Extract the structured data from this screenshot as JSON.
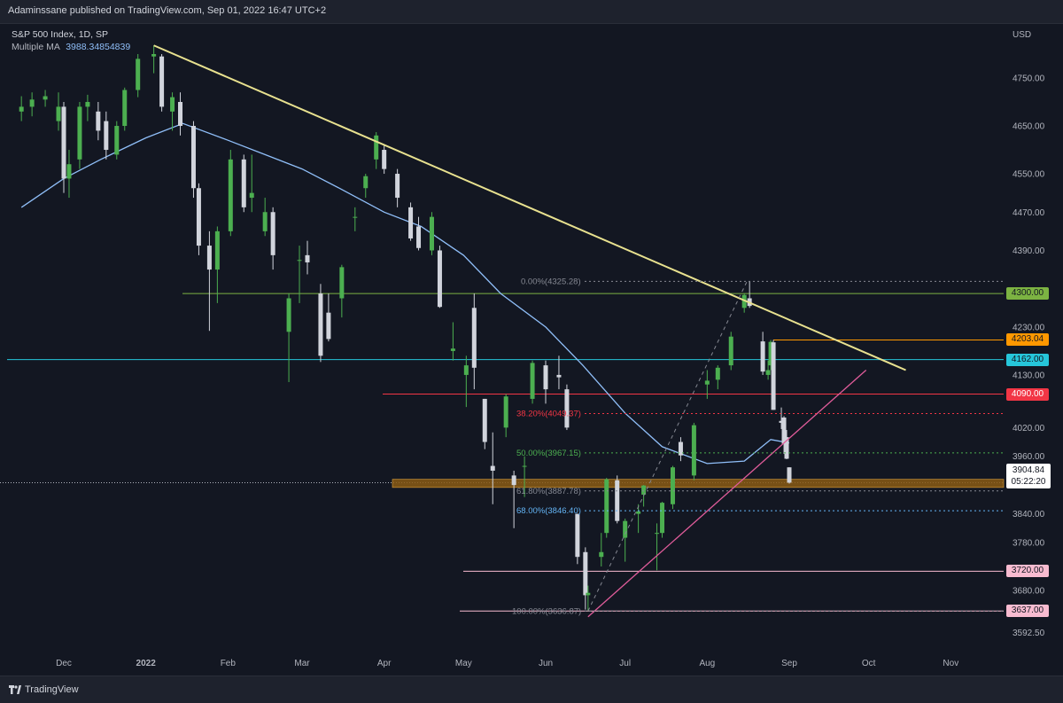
{
  "header": {
    "published_line": "Adaminssane published on TradingView.com, Sep 01, 2022 16:47 UTC+2"
  },
  "legend": {
    "symbol_line": "S&P 500 Index, 1D, SP",
    "ma_label": "Multiple MA",
    "ma_value": "3988.34854839"
  },
  "footer": {
    "brand": "TradingView"
  },
  "colors": {
    "background": "#131722",
    "up_candle": "#4caf50",
    "down_candle": "#d1d4dc",
    "ma_line": "#90bff9",
    "trend_line_yellow": "#e8e18f",
    "support_pink": "#e05c9a",
    "level_cyan": "#26c6da",
    "level_red": "#f23645",
    "level_orange": "#ff9800",
    "level_green": "#7cb342",
    "zone_orange": "#8a5a14"
  },
  "chart_data": {
    "type": "candlestick",
    "title": "S&P 500 Index, 1D, SP",
    "currency_label": "USD",
    "x_tick_labels": [
      "Dec",
      "2022",
      "Feb",
      "Mar",
      "Apr",
      "May",
      "Jun",
      "Jul",
      "Aug",
      "Sep",
      "Oct",
      "Nov"
    ],
    "y_tick_labels": [
      4750,
      4650,
      4550,
      4470,
      4390,
      4230,
      4130,
      4020,
      3960,
      3840,
      3780,
      3680,
      3592.5
    ],
    "ylim": [
      3560,
      4850
    ],
    "grid": false,
    "last_price": "3904.84",
    "countdown": "05:22:20",
    "horizontal_levels": [
      {
        "value": 4300.0,
        "label": "4300.00",
        "color": "#7cb342"
      },
      {
        "value": 4203.04,
        "label": "4203.04",
        "color": "#ff9800"
      },
      {
        "value": 4162.0,
        "label": "4162.00",
        "color": "#26c6da"
      },
      {
        "value": 4090.0,
        "label": "4090.00",
        "color": "#f23645"
      },
      {
        "value": 3720.0,
        "label": "3720.00",
        "color": "#f8bbd0"
      },
      {
        "value": 3637.0,
        "label": "3637.00",
        "color": "#f8bbd0"
      }
    ],
    "fibonacci": [
      {
        "label": "0.00%(4325.28)",
        "value": 4325.28,
        "color": "#868993"
      },
      {
        "label": "38.20%(4049.37)",
        "value": 4049.37,
        "color": "#f23645"
      },
      {
        "label": "50.00%(3967.15)",
        "value": 3967.15,
        "color": "#4caf50"
      },
      {
        "label": "61.80%(3887.78)",
        "value": 3887.78,
        "color": "#868993"
      },
      {
        "label": "68.00%(3846.40)",
        "value": 3846.4,
        "color": "#64b5f6"
      },
      {
        "label": "100.00%(3636.87)",
        "value": 3636.87,
        "color": "#868993"
      }
    ],
    "support_zone": [
      3895,
      3912
    ],
    "downtrend_line": [
      {
        "date": "2022-01-04",
        "value": 4818
      },
      {
        "date": "2022-10-15",
        "value": 4140
      }
    ],
    "uptrend_line": [
      {
        "date": "2022-06-17",
        "value": 3625
      },
      {
        "date": "2022-09-30",
        "value": 4140
      }
    ],
    "moving_average": [
      {
        "date": "2021-11-15",
        "value": 4480
      },
      {
        "date": "2021-12-01",
        "value": 4540
      },
      {
        "date": "2021-12-15",
        "value": 4580
      },
      {
        "date": "2022-01-01",
        "value": 4625
      },
      {
        "date": "2022-01-15",
        "value": 4655
      },
      {
        "date": "2022-02-01",
        "value": 4620
      },
      {
        "date": "2022-02-15",
        "value": 4590
      },
      {
        "date": "2022-03-01",
        "value": 4560
      },
      {
        "date": "2022-03-15",
        "value": 4520
      },
      {
        "date": "2022-04-01",
        "value": 4470
      },
      {
        "date": "2022-04-15",
        "value": 4440
      },
      {
        "date": "2022-05-01",
        "value": 4380
      },
      {
        "date": "2022-05-15",
        "value": 4300
      },
      {
        "date": "2022-06-01",
        "value": 4230
      },
      {
        "date": "2022-06-15",
        "value": 4150
      },
      {
        "date": "2022-07-01",
        "value": 4050
      },
      {
        "date": "2022-07-15",
        "value": 3980
      },
      {
        "date": "2022-08-01",
        "value": 3945
      },
      {
        "date": "2022-08-15",
        "value": 3950
      },
      {
        "date": "2022-08-25",
        "value": 3995
      },
      {
        "date": "2022-09-01",
        "value": 3988
      }
    ],
    "candles": [
      {
        "date": "2021-11-15",
        "open": 4680,
        "high": 4712,
        "low": 4660,
        "close": 4690
      },
      {
        "date": "2021-11-19",
        "open": 4690,
        "high": 4720,
        "low": 4670,
        "close": 4705
      },
      {
        "date": "2021-11-24",
        "open": 4705,
        "high": 4725,
        "low": 4690,
        "close": 4712
      },
      {
        "date": "2021-11-29",
        "open": 4660,
        "high": 4720,
        "low": 4640,
        "close": 4690
      },
      {
        "date": "2021-12-01",
        "open": 4690,
        "high": 4700,
        "low": 4510,
        "close": 4540
      },
      {
        "date": "2021-12-03",
        "open": 4540,
        "high": 4600,
        "low": 4500,
        "close": 4570
      },
      {
        "date": "2021-12-07",
        "open": 4580,
        "high": 4700,
        "low": 4560,
        "close": 4690
      },
      {
        "date": "2021-12-10",
        "open": 4690,
        "high": 4715,
        "low": 4660,
        "close": 4700
      },
      {
        "date": "2021-12-14",
        "open": 4680,
        "high": 4700,
        "low": 4620,
        "close": 4640
      },
      {
        "date": "2021-12-17",
        "open": 4660,
        "high": 4680,
        "low": 4580,
        "close": 4600
      },
      {
        "date": "2021-12-21",
        "open": 4590,
        "high": 4660,
        "low": 4580,
        "close": 4650
      },
      {
        "date": "2021-12-24",
        "open": 4650,
        "high": 4730,
        "low": 4640,
        "close": 4725
      },
      {
        "date": "2021-12-29",
        "open": 4725,
        "high": 4800,
        "low": 4710,
        "close": 4790
      },
      {
        "date": "2022-01-04",
        "open": 4795,
        "high": 4818,
        "low": 4760,
        "close": 4800
      },
      {
        "date": "2022-01-07",
        "open": 4795,
        "high": 4800,
        "low": 4680,
        "close": 4690
      },
      {
        "date": "2022-01-11",
        "open": 4680,
        "high": 4720,
        "low": 4640,
        "close": 4710
      },
      {
        "date": "2022-01-14",
        "open": 4700,
        "high": 4720,
        "low": 4630,
        "close": 4650
      },
      {
        "date": "2022-01-19",
        "open": 4650,
        "high": 4660,
        "low": 4500,
        "close": 4520
      },
      {
        "date": "2022-01-21",
        "open": 4520,
        "high": 4530,
        "low": 4380,
        "close": 4400
      },
      {
        "date": "2022-01-25",
        "open": 4400,
        "high": 4430,
        "low": 4222,
        "close": 4350
      },
      {
        "date": "2022-01-28",
        "open": 4350,
        "high": 4440,
        "low": 4280,
        "close": 4430
      },
      {
        "date": "2022-02-02",
        "open": 4430,
        "high": 4600,
        "low": 4420,
        "close": 4580
      },
      {
        "date": "2022-02-07",
        "open": 4580,
        "high": 4590,
        "low": 4470,
        "close": 4480
      },
      {
        "date": "2022-02-10",
        "open": 4500,
        "high": 4590,
        "low": 4470,
        "close": 4510
      },
      {
        "date": "2022-02-15",
        "open": 4430,
        "high": 4500,
        "low": 4420,
        "close": 4470
      },
      {
        "date": "2022-02-18",
        "open": 4470,
        "high": 4480,
        "low": 4350,
        "close": 4380
      },
      {
        "date": "2022-02-24",
        "open": 4220,
        "high": 4300,
        "low": 4115,
        "close": 4290
      },
      {
        "date": "2022-02-28",
        "open": 4370,
        "high": 4400,
        "low": 4280,
        "close": 4370
      },
      {
        "date": "2022-03-03",
        "open": 4380,
        "high": 4410,
        "low": 4340,
        "close": 4365
      },
      {
        "date": "2022-03-08",
        "open": 4300,
        "high": 4320,
        "low": 4157,
        "close": 4170
      },
      {
        "date": "2022-03-11",
        "open": 4260,
        "high": 4300,
        "low": 4200,
        "close": 4205
      },
      {
        "date": "2022-03-16",
        "open": 4290,
        "high": 4360,
        "low": 4250,
        "close": 4355
      },
      {
        "date": "2022-03-21",
        "open": 4460,
        "high": 4480,
        "low": 4430,
        "close": 4460
      },
      {
        "date": "2022-03-25",
        "open": 4520,
        "high": 4550,
        "low": 4500,
        "close": 4545
      },
      {
        "date": "2022-03-29",
        "open": 4580,
        "high": 4637,
        "low": 4560,
        "close": 4630
      },
      {
        "date": "2022-04-01",
        "open": 4600,
        "high": 4610,
        "low": 4550,
        "close": 4560
      },
      {
        "date": "2022-04-06",
        "open": 4550,
        "high": 4560,
        "low": 4480,
        "close": 4500
      },
      {
        "date": "2022-04-11",
        "open": 4480,
        "high": 4490,
        "low": 4410,
        "close": 4415
      },
      {
        "date": "2022-04-14",
        "open": 4440,
        "high": 4460,
        "low": 4390,
        "close": 4395
      },
      {
        "date": "2022-04-19",
        "open": 4390,
        "high": 4470,
        "low": 4380,
        "close": 4460
      },
      {
        "date": "2022-04-22",
        "open": 4390,
        "high": 4400,
        "low": 4270,
        "close": 4272
      },
      {
        "date": "2022-04-27",
        "open": 4180,
        "high": 4240,
        "low": 4160,
        "close": 4185
      },
      {
        "date": "2022-05-02",
        "open": 4130,
        "high": 4170,
        "low": 4063,
        "close": 4150
      },
      {
        "date": "2022-05-05",
        "open": 4270,
        "high": 4300,
        "low": 4100,
        "close": 4145
      },
      {
        "date": "2022-05-09",
        "open": 4080,
        "high": 4080,
        "low": 3975,
        "close": 3990
      },
      {
        "date": "2022-05-12",
        "open": 3940,
        "high": 4010,
        "low": 3860,
        "close": 3930
      },
      {
        "date": "2022-05-17",
        "open": 4020,
        "high": 4090,
        "low": 4000,
        "close": 4085
      },
      {
        "date": "2022-05-20",
        "open": 3920,
        "high": 3930,
        "low": 3810,
        "close": 3900
      },
      {
        "date": "2022-05-24",
        "open": 3940,
        "high": 3960,
        "low": 3875,
        "close": 3940
      },
      {
        "date": "2022-05-27",
        "open": 4080,
        "high": 4160,
        "low": 4070,
        "close": 4155
      },
      {
        "date": "2022-06-01",
        "open": 4150,
        "high": 4160,
        "low": 4070,
        "close": 4100
      },
      {
        "date": "2022-06-06",
        "open": 4130,
        "high": 4170,
        "low": 4100,
        "close": 4125
      },
      {
        "date": "2022-06-09",
        "open": 4100,
        "high": 4110,
        "low": 4015,
        "close": 4020
      },
      {
        "date": "2022-06-13",
        "open": 3840,
        "high": 3840,
        "low": 3735,
        "close": 3750
      },
      {
        "date": "2022-06-16",
        "open": 3760,
        "high": 3770,
        "low": 3640,
        "close": 3670
      },
      {
        "date": "2022-06-17",
        "open": 3670,
        "high": 3690,
        "low": 3637,
        "close": 3675
      },
      {
        "date": "2022-06-22",
        "open": 3750,
        "high": 3800,
        "low": 3730,
        "close": 3760
      },
      {
        "date": "2022-06-24",
        "open": 3800,
        "high": 3915,
        "low": 3790,
        "close": 3912
      },
      {
        "date": "2022-06-28",
        "open": 3910,
        "high": 3920,
        "low": 3820,
        "close": 3825
      },
      {
        "date": "2022-07-01",
        "open": 3790,
        "high": 3830,
        "low": 3740,
        "close": 3825
      },
      {
        "date": "2022-07-06",
        "open": 3840,
        "high": 3860,
        "low": 3800,
        "close": 3845
      },
      {
        "date": "2022-07-08",
        "open": 3880,
        "high": 3900,
        "low": 3855,
        "close": 3899
      },
      {
        "date": "2022-07-13",
        "open": 3800,
        "high": 3820,
        "low": 3722,
        "close": 3800
      },
      {
        "date": "2022-07-15",
        "open": 3800,
        "high": 3865,
        "low": 3790,
        "close": 3863
      },
      {
        "date": "2022-07-19",
        "open": 3860,
        "high": 3940,
        "low": 3850,
        "close": 3937
      },
      {
        "date": "2022-07-22",
        "open": 3990,
        "high": 4000,
        "low": 3950,
        "close": 3962
      },
      {
        "date": "2022-07-27",
        "open": 3920,
        "high": 4030,
        "low": 3910,
        "close": 4025
      },
      {
        "date": "2022-08-01",
        "open": 4110,
        "high": 4140,
        "low": 4080,
        "close": 4118
      },
      {
        "date": "2022-08-05",
        "open": 4120,
        "high": 4150,
        "low": 4100,
        "close": 4145
      },
      {
        "date": "2022-08-10",
        "open": 4150,
        "high": 4220,
        "low": 4140,
        "close": 4210
      },
      {
        "date": "2022-08-15",
        "open": 4270,
        "high": 4300,
        "low": 4260,
        "close": 4297
      },
      {
        "date": "2022-08-17",
        "open": 4290,
        "high": 4325,
        "low": 4270,
        "close": 4274
      },
      {
        "date": "2022-08-22",
        "open": 4200,
        "high": 4220,
        "low": 4130,
        "close": 4137
      },
      {
        "date": "2022-08-24",
        "open": 4130,
        "high": 4160,
        "low": 4120,
        "close": 4140
      },
      {
        "date": "2022-08-25",
        "open": 4150,
        "high": 4203,
        "low": 4140,
        "close": 4199
      },
      {
        "date": "2022-08-26",
        "open": 4198,
        "high": 4203,
        "low": 4057,
        "close": 4057
      },
      {
        "date": "2022-08-29",
        "open": 4034,
        "high": 4062,
        "low": 4017,
        "close": 4030
      },
      {
        "date": "2022-08-30",
        "open": 4041,
        "high": 4044,
        "low": 3965,
        "close": 3986
      },
      {
        "date": "2022-08-31",
        "open": 4000,
        "high": 4015,
        "low": 3954,
        "close": 3955
      },
      {
        "date": "2022-09-01",
        "open": 3937,
        "high": 3937,
        "low": 3903,
        "close": 3905
      }
    ]
  }
}
